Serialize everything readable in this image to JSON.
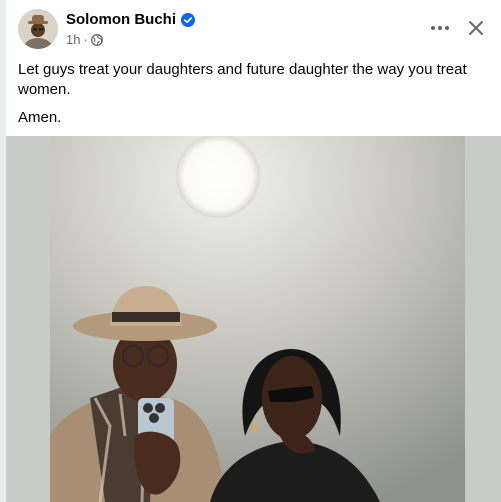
{
  "post": {
    "author": "Solomon Buchi",
    "time": "1h",
    "separator": "·",
    "text_line1": "Let guys treat your daughters and future daughter the way you treat women.",
    "text_line2": "Amen.",
    "icons": {
      "verified": "verified-badge-icon",
      "audience": "globe-icon",
      "more": "more-horizontal-icon",
      "close": "close-icon"
    },
    "colors": {
      "verified_blue": "#0866ff",
      "meta_gray": "#65676b"
    }
  }
}
